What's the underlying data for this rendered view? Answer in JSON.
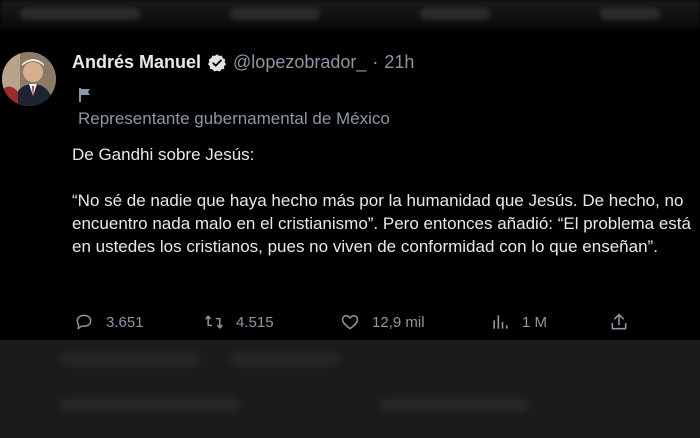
{
  "tweet": {
    "display_name": "Andrés Manuel",
    "handle": "@lopezobrador_",
    "separator": "·",
    "time": "21h",
    "label": "Representante gubernamental de México",
    "lines": [
      "De Gandhi sobre Jesús:",
      "“No sé de nadie que haya hecho más por la humanidad que Jesús. De hecho, no encuentro nada malo en el cristianismo”. Pero entonces añadió: “El problema está en ustedes los cristianos, pues no viven de conformidad con lo que enseñan”."
    ],
    "stats": {
      "replies": "3.651",
      "retweets": "4.515",
      "likes": "12,9 mil",
      "views": "1 M"
    }
  },
  "colors": {
    "background": "#000000",
    "text": "#e7e9ea",
    "secondary": "#8b98a5",
    "verified": "#1d9bf0"
  },
  "icons": {
    "verified": "verified-badge-icon",
    "flag": "flag-icon",
    "reply": "reply-icon",
    "retweet": "retweet-icon",
    "like": "heart-icon",
    "views": "views-chart-icon",
    "share": "share-icon"
  }
}
